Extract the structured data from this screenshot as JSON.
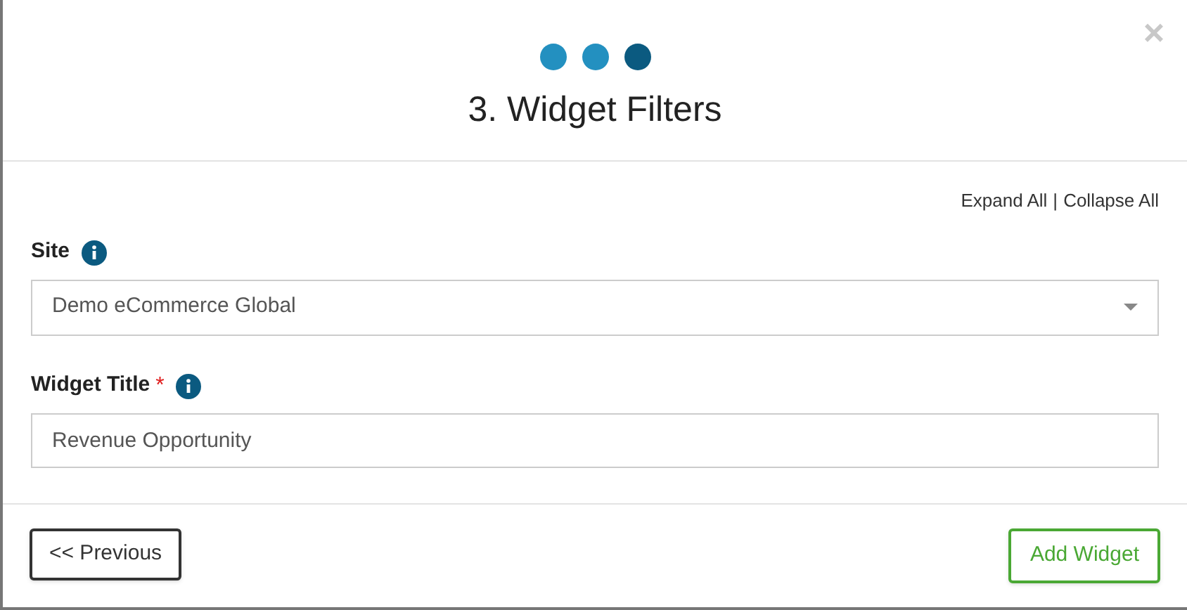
{
  "dialog": {
    "close": "×",
    "steps": [
      {
        "selected": false
      },
      {
        "selected": false
      },
      {
        "selected": true
      }
    ],
    "title": "3. Widget Filters"
  },
  "links": {
    "expand": "Expand All",
    "separator": "|",
    "collapse": "Collapse All"
  },
  "fields": [
    {
      "kind": "select",
      "label": "Site",
      "required": false,
      "value": "Demo eCommerce Global"
    },
    {
      "kind": "text",
      "label": "Widget Title",
      "required": true,
      "required_mark": "*",
      "value": "Revenue Opportunity"
    }
  ],
  "footer": {
    "previous": "<< Previous",
    "submit": "Add Widget"
  }
}
